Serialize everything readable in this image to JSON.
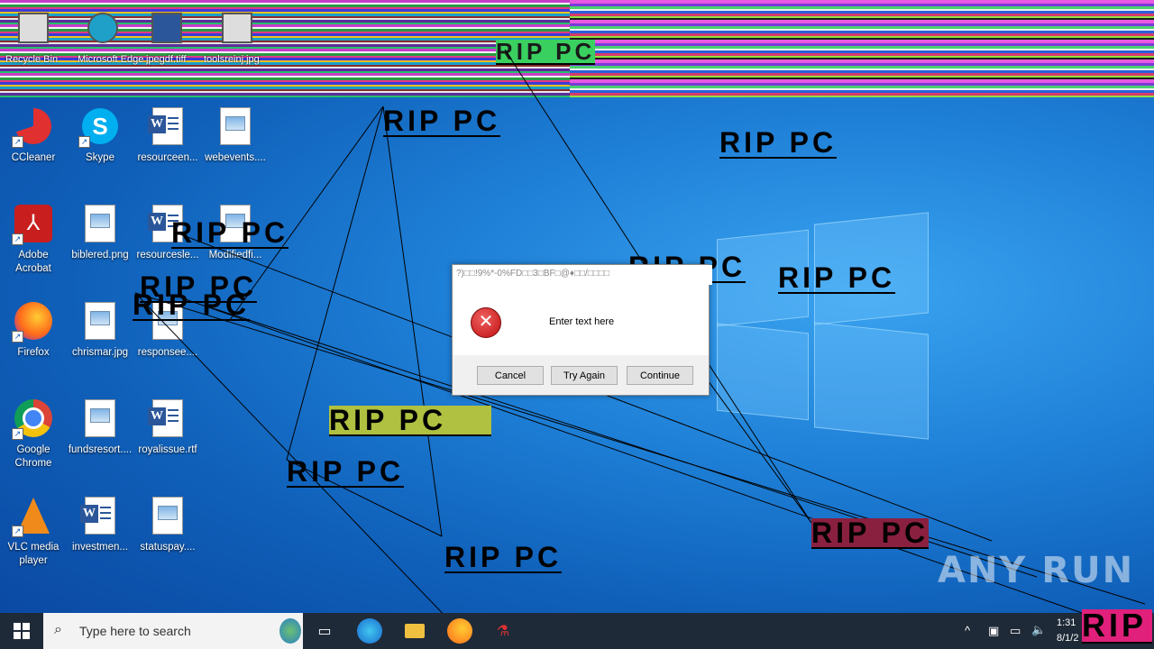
{
  "glitch_labels": [
    "Recycle Bin",
    "Microsoft Edge",
    "jpegdf.tiff",
    "toolsreinj.jpg"
  ],
  "desktop_icons": [
    {
      "label": "CCleaner",
      "type": "app"
    },
    {
      "label": "Skype",
      "type": "app"
    },
    {
      "label": "resourceen...",
      "type": "doc"
    },
    {
      "label": "webevents....",
      "type": "image"
    },
    {
      "label": "Adobe Acrobat",
      "type": "app"
    },
    {
      "label": "biblered.png",
      "type": "image"
    },
    {
      "label": "resourcesle...",
      "type": "doc"
    },
    {
      "label": "Modifiedfi...",
      "type": "image"
    },
    {
      "label": "Firefox",
      "type": "app"
    },
    {
      "label": "chrismar.jpg",
      "type": "image"
    },
    {
      "label": "responsee....",
      "type": "image"
    },
    {
      "label": "Google Chrome",
      "type": "app"
    },
    {
      "label": "fundsresort....",
      "type": "image"
    },
    {
      "label": "royalissue.rtf",
      "type": "doc"
    },
    {
      "label": "VLC media player",
      "type": "app"
    },
    {
      "label": "investmen...",
      "type": "doc"
    },
    {
      "label": "statuspay....",
      "type": "image"
    }
  ],
  "overlay_text": "RIP PC",
  "dialog": {
    "title": "?)□□!9%*-0%FD□□3□BF□@♦□□/□□□□",
    "message": "Enter text here",
    "buttons": {
      "cancel": "Cancel",
      "try_again": "Try Again",
      "continue": "Continue"
    }
  },
  "taskbar": {
    "search_placeholder": "Type here to search",
    "time": "1:31",
    "date": "8/1/2"
  },
  "watermark": "ANY RUN",
  "colors": {
    "error": "#c01010",
    "taskbar": "#1f2a38",
    "desktop": "#1e7fd6"
  }
}
